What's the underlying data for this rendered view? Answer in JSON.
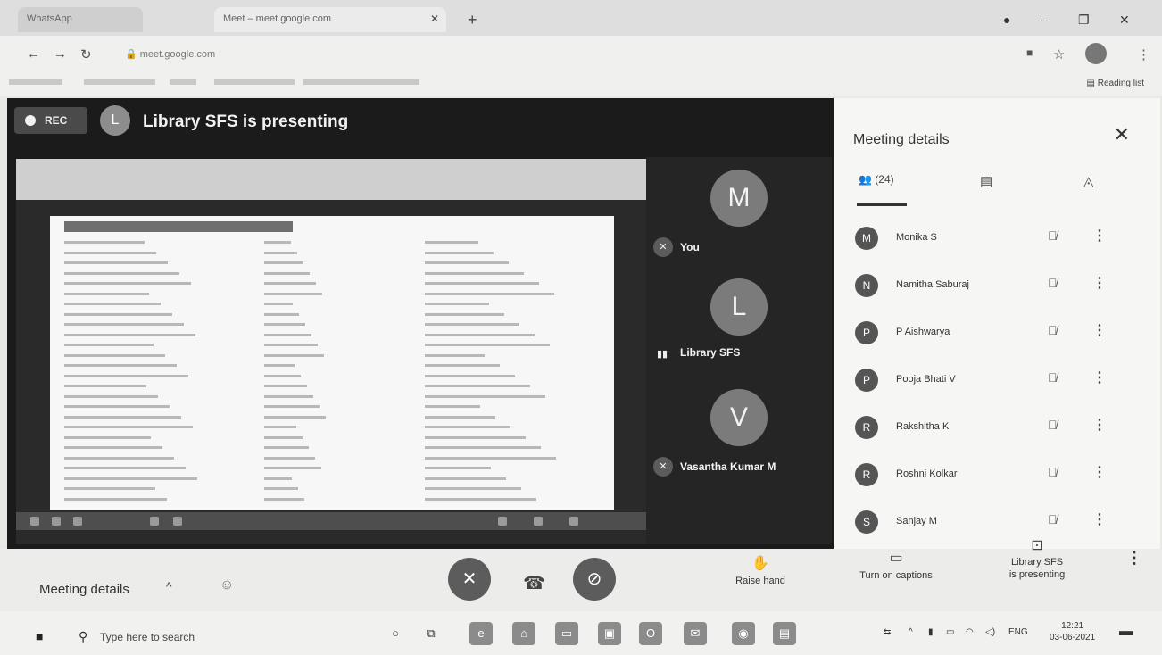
{
  "browser": {
    "tab1_title": "WhatsApp",
    "tab2_title": "Meet – meet.google.com",
    "url": "meet.google.com",
    "reading_list": "Reading list"
  },
  "meet": {
    "rec_label": "REC",
    "presenter_initial": "L",
    "presenting_title": "Library SFS is presenting",
    "participants": [
      {
        "initial": "M",
        "name": "You"
      },
      {
        "initial": "L",
        "name": "Library SFS"
      },
      {
        "initial": "V",
        "name": "Vasantha Kumar M"
      }
    ]
  },
  "panel": {
    "title": "Meeting details",
    "people_count": "(24)",
    "people": [
      {
        "initial": "M",
        "name": "Monika S"
      },
      {
        "initial": "N",
        "name": "Namitha Saburaj"
      },
      {
        "initial": "P",
        "name": "P Aishwarya"
      },
      {
        "initial": "P",
        "name": "Pooja Bhati V"
      },
      {
        "initial": "R",
        "name": "Rakshitha K"
      },
      {
        "initial": "R",
        "name": "Roshni Kolkar"
      },
      {
        "initial": "S",
        "name": "Sanjay M"
      }
    ]
  },
  "bottombar": {
    "meeting_details": "Meeting details",
    "raise_hand": "Raise hand",
    "captions": "Turn on captions",
    "presenting_line1": "Library SFS",
    "presenting_line2": "is presenting"
  },
  "taskbar": {
    "search_placeholder": "Type here to search",
    "lang": "ENG",
    "time": "12:21",
    "date": "03-06-2021"
  }
}
